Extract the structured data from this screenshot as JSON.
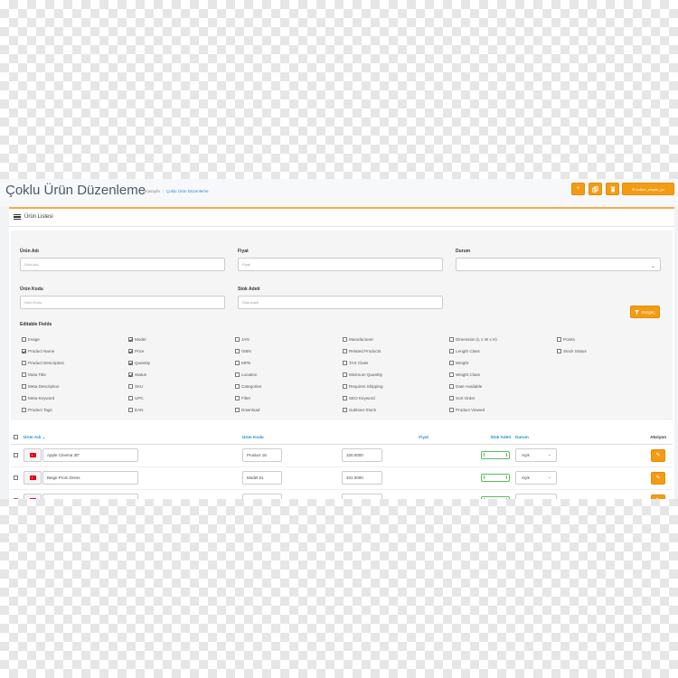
{
  "header": {
    "title": "Çoklu Ürün Düzenleme",
    "breadcrumb": [
      "Anasayfa",
      "Çoklu Ürün Düzenleme"
    ],
    "buttons": {
      "add": "+",
      "copy": "⧉",
      "delete": "🗑",
      "custom": "button_simple_pu"
    }
  },
  "panel": {
    "title": "Ürün Listesi"
  },
  "filters": {
    "name_label": "Ürün Adı",
    "name_placeholder": "Ürün Adı",
    "price_label": "Fiyat",
    "price_placeholder": "Fiyat",
    "status_label": "Durum",
    "status_value": "",
    "code_label": "Ürün Kodu",
    "code_placeholder": "Ürün Kodu",
    "stock_label": "Stok Adeti",
    "stock_placeholder": "Stok Adeti",
    "filter_button": "Süzgeç"
  },
  "editable_fields": {
    "label": "Editable Fields",
    "columns": [
      [
        {
          "label": "Image",
          "checked": false
        },
        {
          "label": "Product Name",
          "checked": true
        },
        {
          "label": "Product Description",
          "checked": false
        },
        {
          "label": "Meta Title",
          "checked": false
        },
        {
          "label": "Meta Description",
          "checked": false
        },
        {
          "label": "Meta Keyword",
          "checked": false
        },
        {
          "label": "Product Tags",
          "checked": false
        }
      ],
      [
        {
          "label": "Model",
          "checked": true
        },
        {
          "label": "Price",
          "checked": true
        },
        {
          "label": "Quantity",
          "checked": true
        },
        {
          "label": "Status",
          "checked": true
        },
        {
          "label": "SKU",
          "checked": false
        },
        {
          "label": "UPC",
          "checked": false
        },
        {
          "label": "EAN",
          "checked": false
        }
      ],
      [
        {
          "label": "JAN",
          "checked": false
        },
        {
          "label": "ISBN",
          "checked": false
        },
        {
          "label": "MPN",
          "checked": false
        },
        {
          "label": "Location",
          "checked": false
        },
        {
          "label": "Categories",
          "checked": false
        },
        {
          "label": "Filter",
          "checked": false
        },
        {
          "label": "Download",
          "checked": false
        }
      ],
      [
        {
          "label": "Manufacturer",
          "checked": false
        },
        {
          "label": "Related Products",
          "checked": false
        },
        {
          "label": "TAX Class",
          "checked": false
        },
        {
          "label": "Minimum Quantity",
          "checked": false
        },
        {
          "label": "Requires Shipping",
          "checked": false
        },
        {
          "label": "SEO Keyword",
          "checked": false
        },
        {
          "label": "Subtract Stock",
          "checked": false
        }
      ],
      [
        {
          "label": "Dimension (L x W x H)",
          "checked": false
        },
        {
          "label": "Length Class",
          "checked": false
        },
        {
          "label": "Weight",
          "checked": false
        },
        {
          "label": "Weight Class",
          "checked": false
        },
        {
          "label": "Date Available",
          "checked": false
        },
        {
          "label": "Sort Order",
          "checked": false
        },
        {
          "label": "Product Viewed",
          "checked": false
        }
      ],
      [
        {
          "label": "Points",
          "checked": false
        },
        {
          "label": "Stock Status",
          "checked": false
        }
      ]
    ]
  },
  "table": {
    "headers": {
      "name": "Ürün Adı",
      "code": "Ürün Kodu",
      "price": "Fiyat",
      "stock": "Stok Adeti",
      "status": "Durum",
      "actions": "Aksiyon"
    },
    "rows": [
      {
        "name": "Apple Cinema 30\"",
        "code": "Product 16",
        "price": "100.0000",
        "status": "Açık"
      },
      {
        "name": "Beige Prom Dress",
        "code": "Model 51",
        "price": "101.0000",
        "status": "Açık"
      },
      {
        "name": "",
        "code": "",
        "price": "",
        "status": ""
      }
    ]
  },
  "colors": {
    "accent": "#f39c12",
    "link": "#1e91cf",
    "stock_ok": "#5cb85c"
  }
}
